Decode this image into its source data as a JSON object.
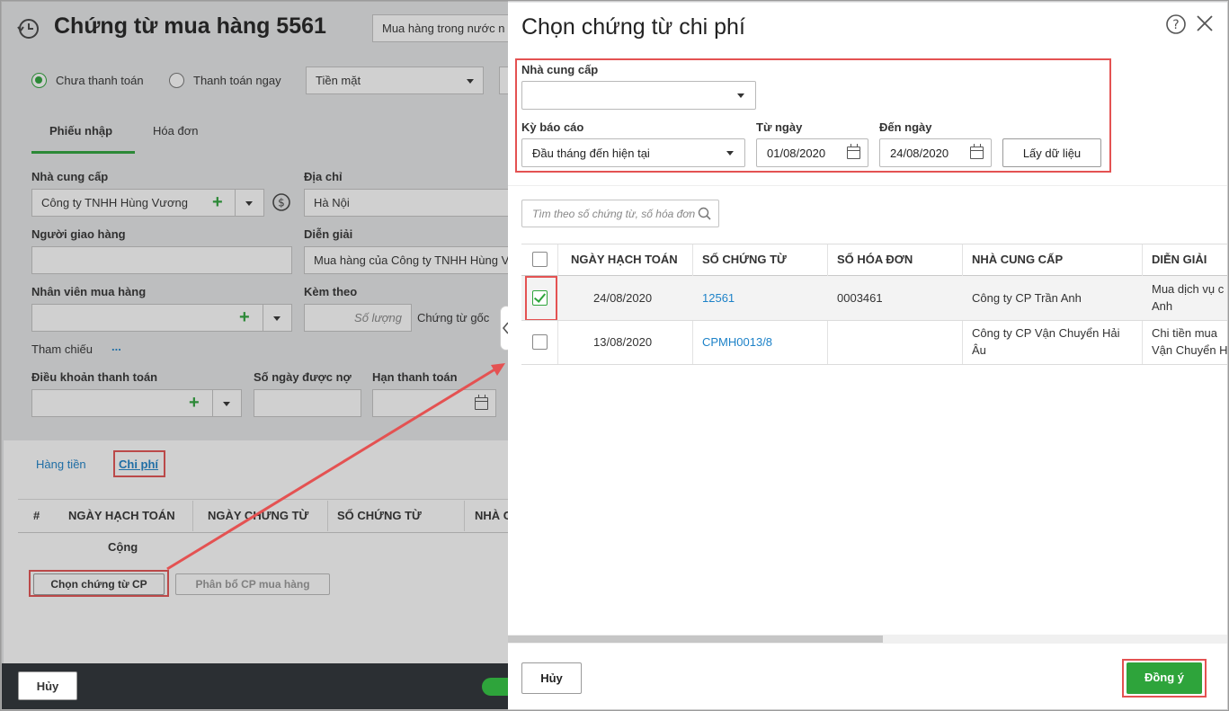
{
  "background_form": {
    "title": "Chứng từ mua hàng 5561",
    "purchase_type": "Mua hàng trong nước n",
    "payment": {
      "unpaid_label": "Chưa thanh toán",
      "pay_now_label": "Thanh toán ngay",
      "method_value": "Tiền mặt"
    },
    "tabs": [
      "Phiếu nhập",
      "Hóa đơn"
    ],
    "fields": {
      "supplier_label": "Nhà cung cấp",
      "supplier_value": "Công ty TNHH Hùng Vương",
      "address_label": "Địa chỉ",
      "address_value": "Hà Nội",
      "deliverer_label": "Người giao hàng",
      "description_label": "Diễn giải",
      "description_value": "Mua hàng của Công ty TNHH Hùng V",
      "buyer_label": "Nhân viên mua hàng",
      "attached_label": "Kèm theo",
      "quantity_placeholder": "Số lượng",
      "original_doc_label": "Chứng từ gốc",
      "reference_label": "Tham chiếu",
      "reference_more": "...",
      "payment_terms_label": "Điều khoản thanh toán",
      "credit_days_label": "Số ngày được nợ",
      "due_date_label": "Hạn thanh toán"
    },
    "detail_tabs": [
      "Hàng tiền",
      "Chi phí"
    ],
    "grid_headers": [
      "#",
      "NGÀY HẠCH TOÁN",
      "NGÀY CHỨNG TỪ",
      "SỐ CHỨNG TỪ",
      "NHÀ C"
    ],
    "total_label": "Cộng",
    "select_cost_button": "Chọn chứng từ CP",
    "allocate_button": "Phân bổ CP mua hàng",
    "cancel_button": "Hủy"
  },
  "dialog": {
    "title": "Chọn chứng từ chi phí",
    "filters": {
      "supplier_label": "Nhà cung cấp",
      "supplier_value": "",
      "period_label": "Kỳ báo cáo",
      "period_value": "Đầu tháng đến hiện tại",
      "from_label": "Từ ngày",
      "from_value": "01/08/2020",
      "to_label": "Đến ngày",
      "to_value": "24/08/2020",
      "get_data_button": "Lấy dữ liệu"
    },
    "search_placeholder": "Tìm theo số chứng từ, số hóa đơn",
    "columns": [
      "NGÀY HẠCH TOÁN",
      "SỐ CHỨNG TỪ",
      "SỐ HÓA ĐƠN",
      "NHÀ CUNG CẤP",
      "DIỄN GIẢI"
    ],
    "rows": [
      {
        "checked": true,
        "posting_date": "24/08/2020",
        "doc_no": "12561",
        "invoice_no": "0003461",
        "supplier": "Công ty CP Trần Anh",
        "desc_line1": "Mua dịch vụ c",
        "desc_line2": "Anh"
      },
      {
        "checked": false,
        "posting_date": "13/08/2020",
        "doc_no": "CPMH0013/8",
        "invoice_no": "",
        "supplier_line1": "Công ty CP Vận Chuyển Hải",
        "supplier_line2": "Âu",
        "desc_line1": "Chi tiền mua",
        "desc_line2": "Vận Chuyển H"
      }
    ],
    "cancel_button": "Hủy",
    "agree_button": "Đồng ý"
  },
  "colors": {
    "accent_green": "#2ea43b",
    "link_blue": "#1d82c8",
    "highlight_red": "#e45252"
  }
}
